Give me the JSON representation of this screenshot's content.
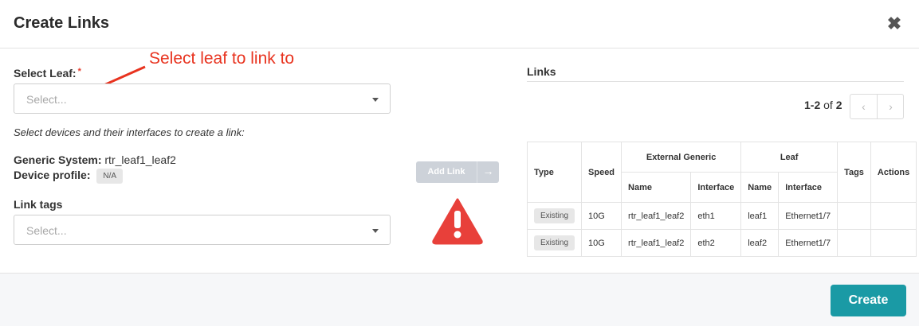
{
  "modal": {
    "title": "Create Links",
    "close_glyph": "✖"
  },
  "annotation": {
    "text": "Select leaf to link to"
  },
  "select_leaf": {
    "label": "Select Leaf:",
    "required_mark": "*",
    "placeholder": "Select..."
  },
  "instructions": "Select devices and their interfaces to create a link:",
  "generic_system": {
    "label": "Generic System:",
    "value": "rtr_leaf1_leaf2"
  },
  "device_profile": {
    "label": "Device profile:",
    "value": "N/A"
  },
  "link_tags": {
    "label": "Link tags",
    "placeholder": "Select..."
  },
  "add_link": {
    "label": "Add Link",
    "arrow": "→"
  },
  "links": {
    "title": "Links",
    "pagination": {
      "range": "1-2",
      "of_label": "of",
      "total": "2",
      "prev": "‹",
      "next": "›"
    },
    "columns": {
      "type": "Type",
      "speed": "Speed",
      "external_generic": "External Generic",
      "leaf": "Leaf",
      "tags": "Tags",
      "actions": "Actions",
      "name": "Name",
      "interface": "Interface"
    },
    "rows": [
      {
        "type": "Existing",
        "speed": "10G",
        "ext_name": "rtr_leaf1_leaf2",
        "ext_interface": "eth1",
        "leaf_name": "leaf1",
        "leaf_interface": "Ethernet1/7",
        "tags": "",
        "actions": ""
      },
      {
        "type": "Existing",
        "speed": "10G",
        "ext_name": "rtr_leaf1_leaf2",
        "ext_interface": "eth2",
        "leaf_name": "leaf2",
        "leaf_interface": "Ethernet1/7",
        "tags": "",
        "actions": ""
      }
    ]
  },
  "footer": {
    "create_label": "Create"
  },
  "colors": {
    "accent": "#1a9aa5",
    "annotation": "#e8331f",
    "warning": "#e8403a",
    "disabled": "#cdd2d9"
  },
  "icons": {
    "close": "close-icon",
    "warning": "warning-icon",
    "caret": "chevron-down-icon",
    "arrow": "arrow-right-icon",
    "annotation_arrow": "annotation-arrow-icon"
  }
}
